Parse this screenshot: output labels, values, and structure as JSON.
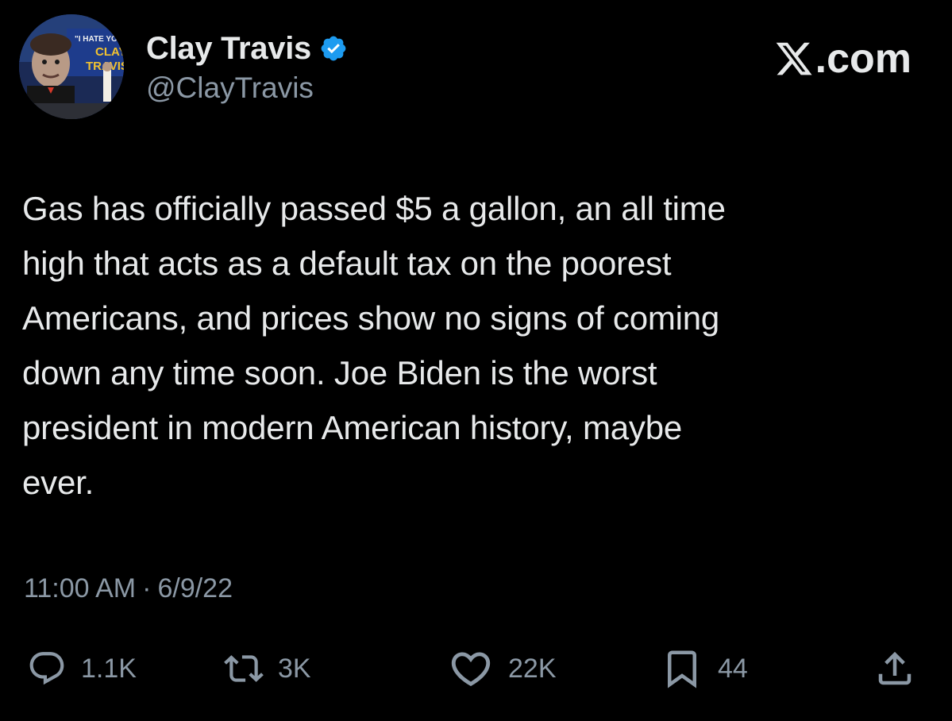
{
  "author": {
    "display_name": "Clay Travis",
    "handle": "@ClayTravis",
    "verified": true,
    "avatar_banner_text": "\"I HATE YOU CLAY TRAVIS\""
  },
  "brand": {
    "label": ".com",
    "logo": "x-logo-icon"
  },
  "tweet": {
    "text": "Gas has officially passed $5 a gallon, an all time\nhigh that acts as a default tax on the poorest\nAmericans, and prices show no signs of coming\ndown any time soon. Joe Biden is the worst\npresident in modern American history, maybe\never.",
    "time": "11:00 AM",
    "separator": "·",
    "date": "6/9/22"
  },
  "actions": {
    "reply": {
      "icon": "reply-icon",
      "count": "1.1K"
    },
    "repost": {
      "icon": "repost-icon",
      "count": "3K"
    },
    "like": {
      "icon": "heart-icon",
      "count": "22K"
    },
    "bookmark": {
      "icon": "bookmark-icon",
      "count": "44"
    },
    "share": {
      "icon": "share-icon"
    }
  },
  "colors": {
    "background": "#000000",
    "text": "#e7e9ea",
    "secondary": "#8b98a5",
    "verified": "#1d9bf0"
  }
}
